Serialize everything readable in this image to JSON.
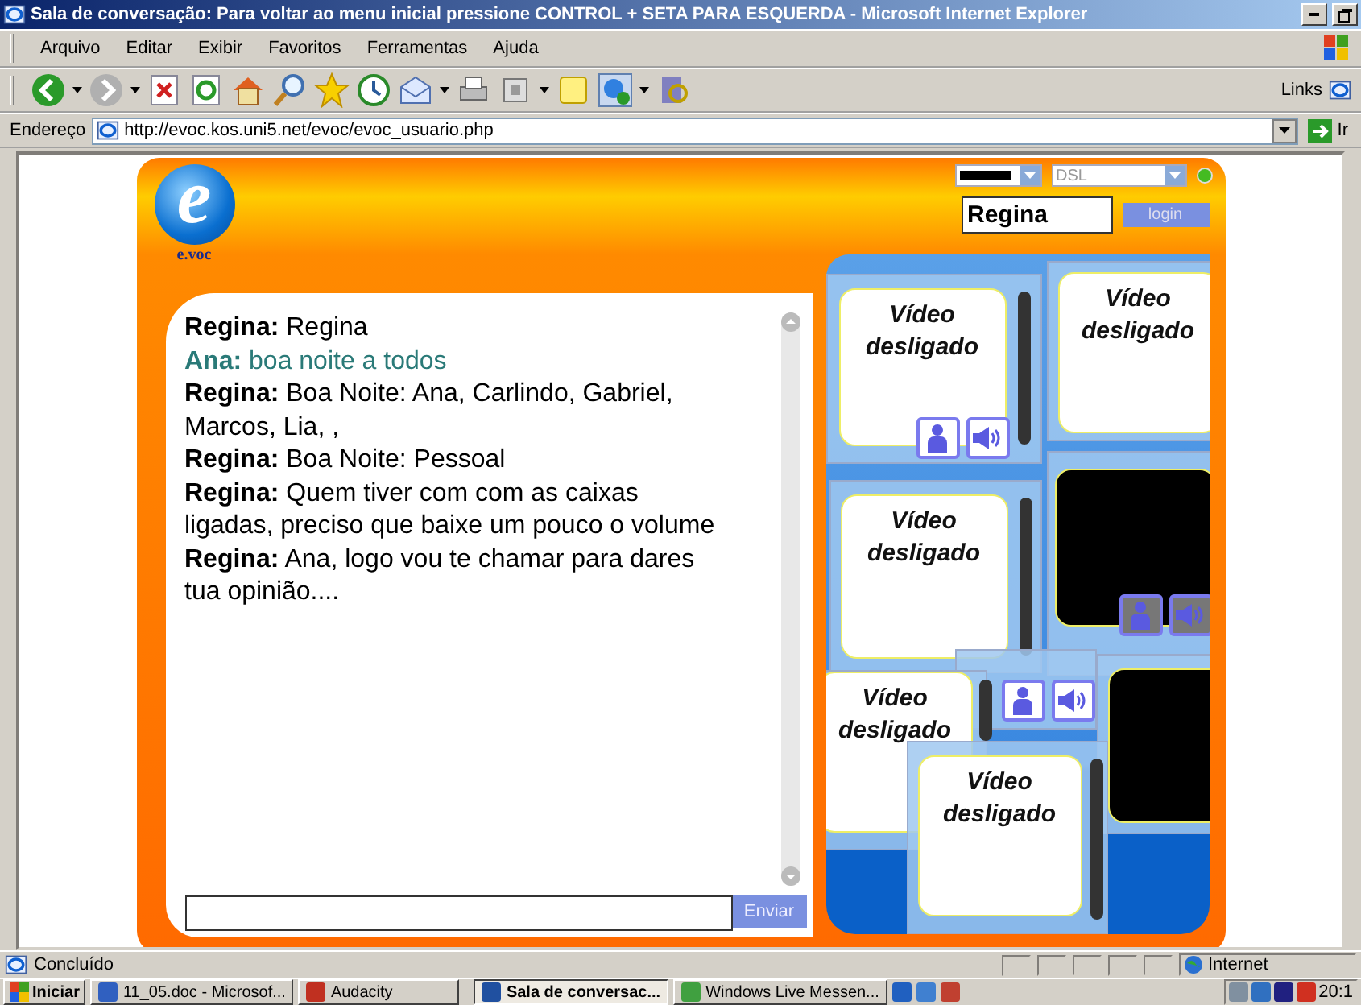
{
  "window": {
    "title": "Sala de conversação: Para voltar ao menu inicial pressione CONTROL + SETA PARA ESQUERDA - Microsoft Internet Explorer"
  },
  "menu": [
    "Arquivo",
    "Editar",
    "Exibir",
    "Favoritos",
    "Ferramentas",
    "Ajuda"
  ],
  "toolbar": {
    "links_label": "Links"
  },
  "address": {
    "label": "Endereço",
    "url": "http://evoc.kos.uni5.net/evoc/evoc_usuario.php",
    "go": "Ir"
  },
  "app": {
    "logo": {
      "mark": "e",
      "caption": "e.voc"
    },
    "connection_select": {
      "value": "DSL"
    },
    "online": true,
    "name_field": {
      "value": "Regina"
    },
    "login": "login",
    "messages": [
      {
        "author": "Regina:",
        "text": "Regina",
        "color": "#000000"
      },
      {
        "author": "Ana:",
        "text": "boa noite a todos",
        "color": "#2a7a78"
      },
      {
        "author": "Regina:",
        "text": "Boa Noite: Ana, Carlindo, Gabriel, Marcos, Lia, ,",
        "color": "#000000"
      },
      {
        "author": "Regina:",
        "text": "Boa Noite: Pessoal",
        "color": "#000000"
      },
      {
        "author": "Regina:",
        "text": "Quem tiver com com as caixas ligadas, preciso que baixe um pouco o volume",
        "color": "#000000"
      },
      {
        "author": "Regina:",
        "text": "Ana, logo vou te chamar para dares tua opinião....",
        "color": "#000000"
      }
    ],
    "send": "Enviar",
    "video_tiles": [
      {
        "kind": "off",
        "label": "Vídeo desligado",
        "controls": true
      },
      {
        "kind": "off",
        "label": "Vídeo desligado",
        "controls": false
      },
      {
        "kind": "off",
        "label": "Vídeo desligado",
        "controls": false
      },
      {
        "kind": "black",
        "controls": true
      },
      {
        "kind": "controls",
        "controls": true
      },
      {
        "kind": "off",
        "label": "Vídeo desligado",
        "controls": false
      },
      {
        "kind": "black",
        "controls": false
      },
      {
        "kind": "off",
        "label": "Vídeo desligado",
        "controls": false
      }
    ]
  },
  "status_bar": {
    "text": "Concluído",
    "zone": "Internet"
  },
  "taskbar": {
    "start": "Iniciar",
    "items": [
      {
        "label": "11_05.doc - Microsof...",
        "selected": false
      },
      {
        "label": "Audacity",
        "selected": false
      },
      {
        "label": "Sala de conversac...",
        "selected": true
      },
      {
        "label": "Windows Live Messen...",
        "selected": false
      }
    ],
    "clock": "20:1"
  }
}
